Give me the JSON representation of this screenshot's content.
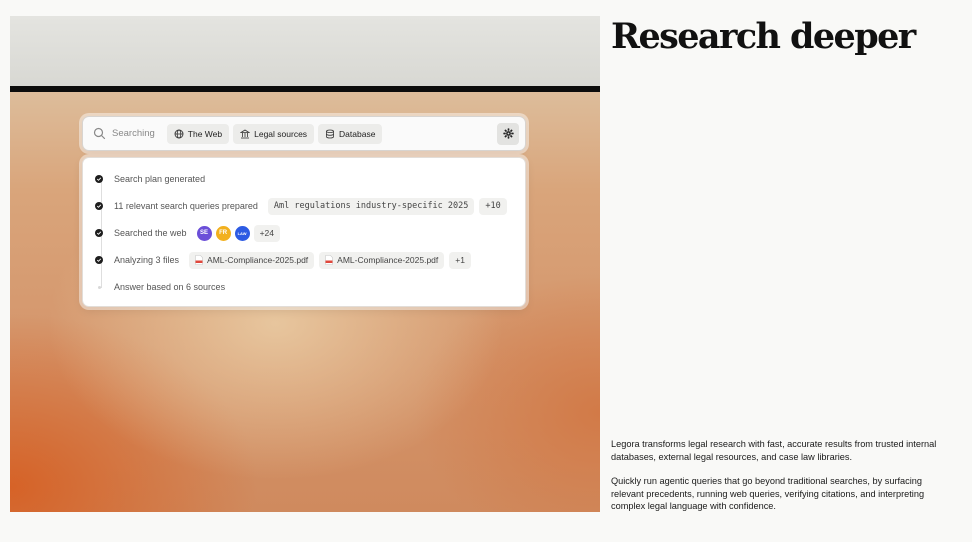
{
  "search": {
    "label": "Searching",
    "chips": [
      {
        "label": "The Web",
        "icon": "globe-icon"
      },
      {
        "label": "Legal sources",
        "icon": "building-icon"
      },
      {
        "label": "Database",
        "icon": "database-icon"
      }
    ],
    "settings_icon": "gear-icon"
  },
  "steps": [
    {
      "text": "Search plan generated",
      "status": "done"
    },
    {
      "text": "11 relevant search queries prepared",
      "status": "done",
      "tags": [
        "Aml regulations industry-specific 2025",
        "+10"
      ]
    },
    {
      "text": "Searched the web",
      "status": "done",
      "favicons": [
        {
          "label": "SE",
          "color": "#6b4fd8"
        },
        {
          "label": "FR",
          "color": "#f2b01e"
        },
        {
          "label": "LAW",
          "color": "#2d5be3"
        }
      ],
      "more": "+24"
    },
    {
      "text": "Analyzing 3 files",
      "status": "done",
      "files": [
        "AML-Compliance-2025.pdf",
        "AML-Compliance-2025.pdf"
      ],
      "more": "+1"
    },
    {
      "text": "Answer based on 6 sources",
      "status": "pending"
    }
  ],
  "heading": "Research deeper",
  "paragraphs": [
    "Legora transforms legal research with fast, accurate results from trusted internal databases, external legal resources, and case law libraries.",
    "Quickly run agentic queries that go beyond traditional searches, by surfacing relevant precedents, running web queries, verifying citations, and interpreting complex legal language with confidence."
  ],
  "colors": {
    "accent": "#d6602a",
    "dark": "#1e1e1e",
    "pdf": "#e0473b"
  }
}
